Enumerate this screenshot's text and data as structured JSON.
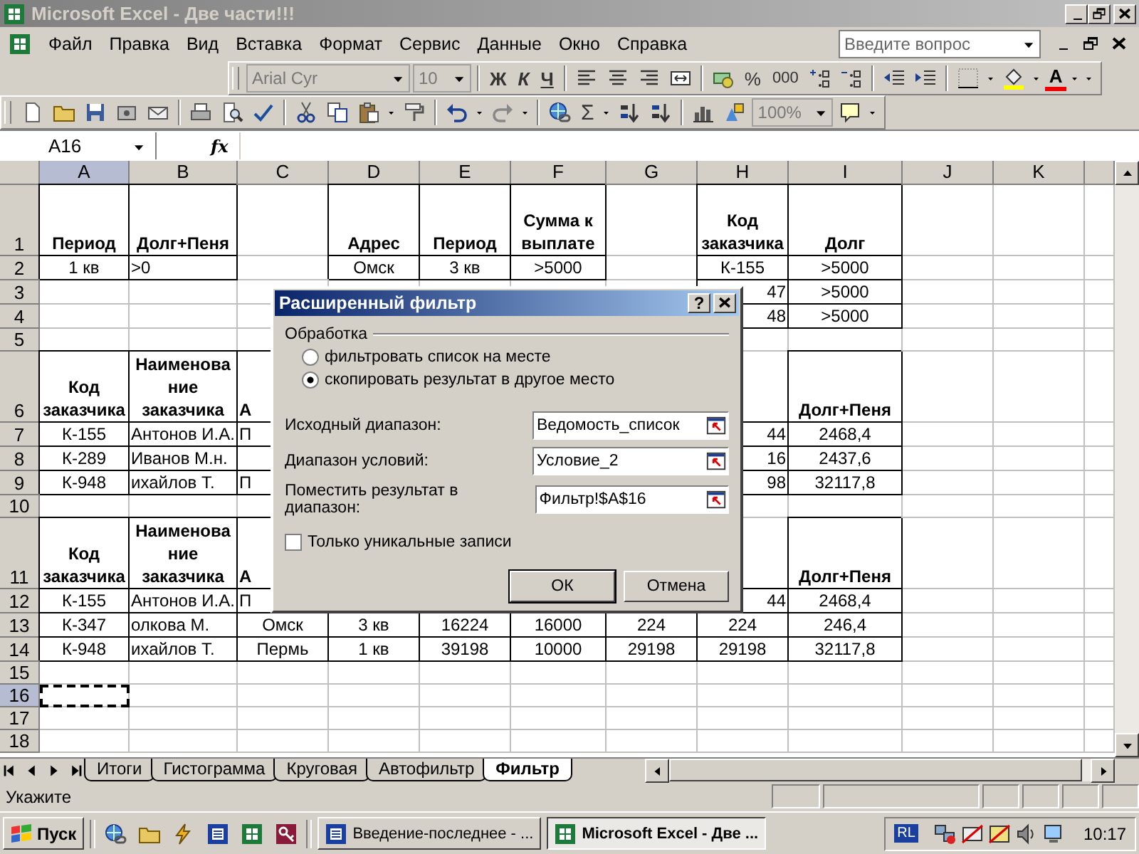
{
  "window": {
    "title": "Microsoft Excel - Две части!!!"
  },
  "menu": [
    "Файл",
    "Правка",
    "Вид",
    "Вставка",
    "Формат",
    "Сервис",
    "Данные",
    "Окно",
    "Справка"
  ],
  "help_box": {
    "placeholder": "Введите вопрос"
  },
  "formatting_toolbar": {
    "font": "Arial Cyr",
    "size": "10",
    "style_buttons": [
      "Ж",
      "К",
      "Ч"
    ],
    "percent": "%",
    "thousands": "000",
    "font_color": "A"
  },
  "standard_toolbar": {
    "sum": "Σ",
    "zoom": "100%"
  },
  "formula_bar": {
    "name_box": "A16",
    "fx": "fx"
  },
  "sheet": {
    "columns": [
      {
        "label": "A",
        "selected": true
      },
      {
        "label": "B",
        "selected": false
      },
      {
        "label": "C",
        "selected": false
      },
      {
        "label": "D",
        "selected": false
      },
      {
        "label": "E",
        "selected": false
      },
      {
        "label": "F",
        "selected": false
      },
      {
        "label": "G",
        "selected": false
      },
      {
        "label": "H",
        "selected": false
      },
      {
        "label": "I",
        "selected": false
      },
      {
        "label": "J",
        "selected": false
      },
      {
        "label": "K",
        "selected": false
      }
    ],
    "rows": [
      {
        "header": "1",
        "selected": false,
        "kind": "heading",
        "cells": {
          "A": {
            "text": "Период"
          },
          "B": {
            "text": "Долг+Пеня"
          },
          "D": {
            "text": "Адрес"
          },
          "E": {
            "text": "Период"
          },
          "F": {
            "text": "Сумма к выплате"
          },
          "H": {
            "text": "Код заказчика"
          },
          "I": {
            "text": "Долг"
          }
        }
      },
      {
        "header": "2",
        "selected": false,
        "kind": "data",
        "cells": {
          "A": {
            "text": "1 кв"
          },
          "B": {
            "text": ">0"
          },
          "D": {
            "text": "Омск"
          },
          "E": {
            "text": "3 кв"
          },
          "F": {
            "text": ">5000"
          },
          "H": {
            "text": "К-155"
          },
          "I": {
            "text": ">5000"
          }
        }
      },
      {
        "header": "3",
        "selected": false,
        "kind": "data",
        "cells": {
          "H": {
            "text": "47",
            "cut_left": true
          },
          "I": {
            "text": ">5000"
          }
        }
      },
      {
        "header": "4",
        "selected": false,
        "kind": "data",
        "cells": {
          "H": {
            "text": "48",
            "cut_left": true
          },
          "I": {
            "text": ">5000"
          }
        }
      },
      {
        "header": "5",
        "selected": false,
        "kind": "data"
      },
      {
        "header": "6",
        "selected": false,
        "kind": "heading",
        "cells": {
          "A": {
            "text": "Код заказчика"
          },
          "B": {
            "text": "Наименование заказчика"
          },
          "C": {
            "text": "А",
            "cut_right": true
          },
          "I": {
            "text": "Долг+Пеня"
          }
        }
      },
      {
        "header": "7",
        "selected": false,
        "kind": "data",
        "cells": {
          "A": {
            "text": "К-155"
          },
          "B": {
            "text": "Антонов И.А."
          },
          "C": {
            "text": "П",
            "cut_right": true
          },
          "H": {
            "text": "44",
            "cut_left": true
          },
          "I": {
            "text": "2468,4"
          }
        }
      },
      {
        "header": "8",
        "selected": false,
        "kind": "data",
        "cells": {
          "A": {
            "text": "К-289"
          },
          "B": {
            "text": "Иванов М.н."
          },
          "H": {
            "text": "16",
            "cut_left": true
          },
          "I": {
            "text": "2437,6"
          }
        }
      },
      {
        "header": "9",
        "selected": false,
        "kind": "data",
        "cells": {
          "A": {
            "text": "К-948"
          },
          "B": {
            "text": "ихайлов Т."
          },
          "C": {
            "text": "П",
            "cut_right": true
          },
          "H": {
            "text": "98",
            "cut_left": true
          },
          "I": {
            "text": "32117,8"
          }
        }
      },
      {
        "header": "10",
        "selected": false,
        "kind": "data"
      },
      {
        "header": "11",
        "selected": false,
        "kind": "heading",
        "cells": {
          "A": {
            "text": "Код заказчика"
          },
          "B": {
            "text": "Наименование заказчика"
          },
          "C": {
            "text": "А",
            "cut_right": true
          },
          "I": {
            "text": "Долг+Пеня"
          }
        }
      },
      {
        "header": "12",
        "selected": false,
        "kind": "data",
        "cells": {
          "A": {
            "text": "К-155"
          },
          "B": {
            "text": "Антонов И.А."
          },
          "C": {
            "text": "П",
            "cut_right": true
          },
          "H": {
            "text": "44",
            "cut_left": true
          },
          "I": {
            "text": "2468,4"
          }
        }
      },
      {
        "header": "13",
        "selected": false,
        "kind": "data",
        "cells": {
          "A": {
            "text": "К-347"
          },
          "B": {
            "text": "олкова М."
          },
          "C": {
            "text": "Омск"
          },
          "D": {
            "text": "3 кв"
          },
          "E": {
            "text": "16224"
          },
          "F": {
            "text": "16000"
          },
          "G": {
            "text": "224"
          },
          "H": {
            "text": "224"
          },
          "I": {
            "text": "246,4"
          }
        }
      },
      {
        "header": "14",
        "selected": false,
        "kind": "data",
        "cells": {
          "A": {
            "text": "К-948"
          },
          "B": {
            "text": "ихайлов Т."
          },
          "C": {
            "text": "Пермь"
          },
          "D": {
            "text": "1 кв"
          },
          "E": {
            "text": "39198"
          },
          "F": {
            "text": "10000"
          },
          "G": {
            "text": "29198"
          },
          "H": {
            "text": "29198"
          },
          "I": {
            "text": "32117,8"
          }
        }
      },
      {
        "header": "15",
        "selected": false,
        "kind": "data"
      },
      {
        "header": "16",
        "selected": true,
        "kind": "data",
        "cells": {
          "A": {
            "marquee": true
          }
        }
      },
      {
        "header": "17",
        "selected": false,
        "kind": "data"
      },
      {
        "header": "18",
        "selected": false,
        "kind": "data"
      }
    ]
  },
  "dialog": {
    "title": "Расширенный фильтр",
    "help": "?",
    "group": "Обработка",
    "options": [
      {
        "label": "фильтровать список на месте",
        "selected": false
      },
      {
        "label": "скопировать результат в другое место",
        "selected": true
      }
    ],
    "fields": [
      {
        "label": "Исходный диапазон:",
        "value": "Ведомость_список"
      },
      {
        "label": "Диапазон условий:",
        "value": "Условие_2"
      },
      {
        "label": "Поместить результат в диапазон:",
        "value": "Фильтр!$A$16"
      }
    ],
    "checkbox": {
      "label": "Только уникальные записи",
      "checked": false
    },
    "buttons": [
      {
        "label": "ОК",
        "default": true
      },
      {
        "label": "Отмена",
        "default": false
      }
    ]
  },
  "sheet_tabs": [
    {
      "label": "Итоги",
      "selected": false
    },
    {
      "label": "Гистограмма",
      "selected": false
    },
    {
      "label": "Круговая",
      "selected": false
    },
    {
      "label": "Автофильтр",
      "selected": false
    },
    {
      "label": "Фильтр",
      "selected": true
    }
  ],
  "status_bar": {
    "text": "Укажите"
  },
  "taskbar": {
    "start": "Пуск",
    "tasks": [
      {
        "label": "Введение-последнее - ...",
        "selected": false,
        "kind": "word"
      },
      {
        "label": "Microsoft Excel - Две ...",
        "selected": true,
        "kind": "excel"
      }
    ],
    "language": "RL",
    "clock": "10:17"
  }
}
